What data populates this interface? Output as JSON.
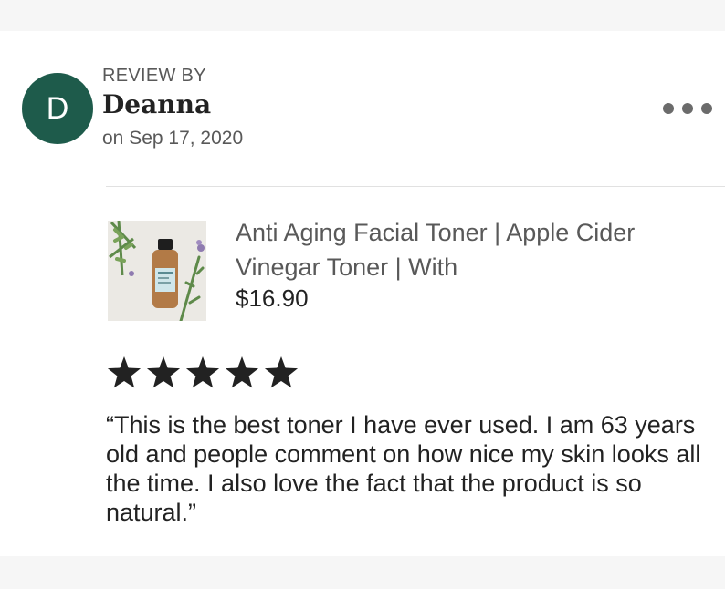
{
  "reviewer": {
    "avatar_letter": "D",
    "review_by_label": "REVIEW BY",
    "name": "Deanna",
    "date": "on Sep 17, 2020"
  },
  "menu": {
    "icon": "more-horizontal-icon"
  },
  "product": {
    "title": "Anti Aging Facial Toner | Apple Cider Vinegar Toner | With",
    "price": "$16.90"
  },
  "rating": {
    "stars": 5,
    "max": 5
  },
  "review": {
    "text": "“This is the best toner I have ever used.  I am 63 years old and people comment on how nice my skin looks all the time.  I also love the fact that the product is so natural.”"
  },
  "colors": {
    "avatar_bg": "#1e5b4b",
    "star": "#222222",
    "muted_text": "#595959",
    "page_bg": "#f6f6f6"
  }
}
